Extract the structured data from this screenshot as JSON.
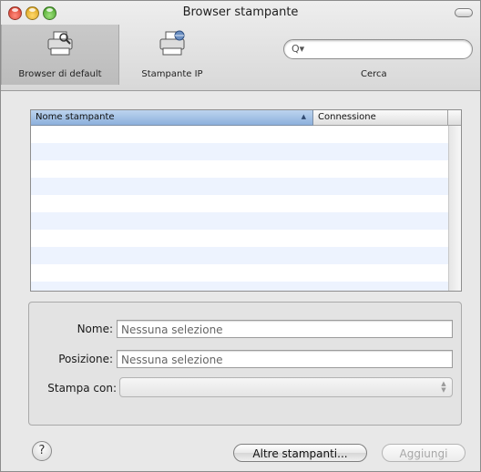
{
  "window": {
    "title": "Browser stampante"
  },
  "toolbar": {
    "items": [
      {
        "label": "Browser di default",
        "icon": "printer-magnifier-icon",
        "selected": true
      },
      {
        "label": "Stampante IP",
        "icon": "network-printer-icon",
        "selected": false
      }
    ],
    "search": {
      "label": "Cerca",
      "placeholder": "",
      "icon": "search-icon"
    }
  },
  "printer_table": {
    "columns": [
      "Nome stampante",
      "Connessione"
    ],
    "sorted_column": "Nome stampante",
    "sort_glyph": "▲",
    "rows": []
  },
  "details": {
    "name_label": "Nome:",
    "name_value": "Nessuna selezione",
    "location_label": "Posizione:",
    "location_value": "Nessuna selezione",
    "print_using_label": "Stampa con:",
    "print_using_value": ""
  },
  "buttons": {
    "help": "?",
    "more_printers": "Altre stampanti...",
    "add": "Aggiungi"
  },
  "colors": {
    "selected_header": "#8cb0dc",
    "alt_row": "#edf3fe"
  }
}
